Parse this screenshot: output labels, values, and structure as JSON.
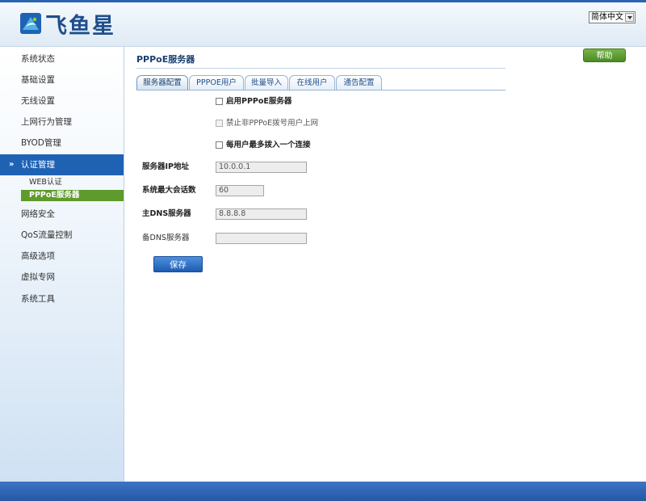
{
  "brand": {
    "name": "飞鱼星"
  },
  "language": {
    "selected": "简体中文"
  },
  "sidebar": {
    "items": [
      {
        "label": "系统状态"
      },
      {
        "label": "基础设置"
      },
      {
        "label": "无线设置"
      },
      {
        "label": "上网行为管理"
      },
      {
        "label": "BYOD管理"
      },
      {
        "label": "认证管理",
        "active": true
      },
      {
        "label": "网络安全"
      },
      {
        "label": "QoS流量控制"
      },
      {
        "label": "高级选项"
      },
      {
        "label": "虚拟专网"
      },
      {
        "label": "系统工具"
      }
    ],
    "subitems": [
      {
        "label": "WEB认证"
      },
      {
        "label": "PPPoE服务器",
        "current": true
      }
    ]
  },
  "page": {
    "title": "PPPoE服务器"
  },
  "help": {
    "label": "帮助"
  },
  "tabs": [
    {
      "label": "服务器配置",
      "active": true
    },
    {
      "label": "PPPOE用户"
    },
    {
      "label": "批量导入"
    },
    {
      "label": "在线用户"
    },
    {
      "label": "通告配置"
    }
  ],
  "form": {
    "enable": {
      "label": "启用PPPoE服务器",
      "checked": false
    },
    "block": {
      "label": "禁止非PPPoE拨号用户上网",
      "checked": false,
      "disabled": true
    },
    "single": {
      "label": "每用户最多拨入一个连接",
      "checked": false
    },
    "ip": {
      "label": "服务器IP地址",
      "value": "10.0.0.1"
    },
    "max_sessions": {
      "label": "系统最大会话数",
      "value": "60"
    },
    "dns_primary": {
      "label": "主DNS服务器",
      "value": "8.8.8.8"
    },
    "dns_secondary": {
      "label": "备DNS服务器",
      "value": ""
    },
    "save_label": "保存"
  },
  "colors": {
    "accent": "#1f62b4",
    "submenu_current": "#5f9a2c",
    "help_button": "#5f9a2c",
    "footer": "#2b5fb0"
  }
}
